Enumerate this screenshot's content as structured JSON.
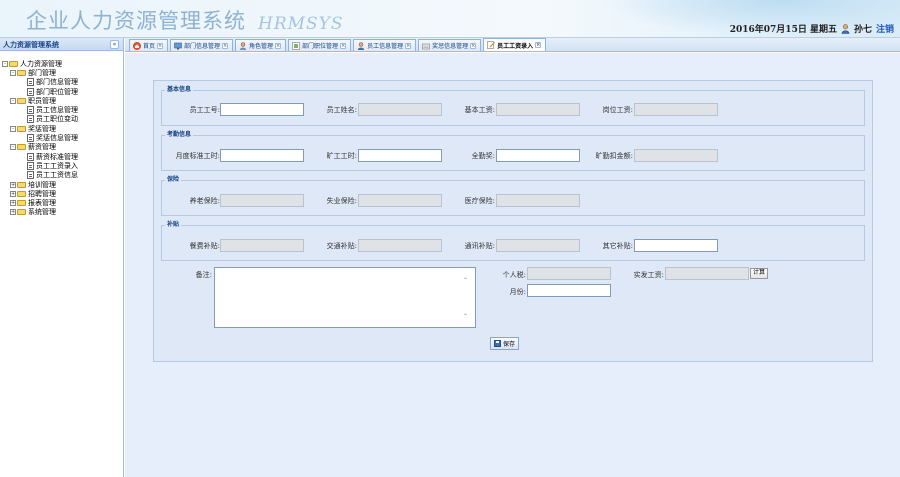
{
  "header": {
    "title": "企业人力资源管理系统",
    "subtitle": "HRMSYS",
    "datetime": "2016年07月15日 星期五",
    "user_name": "孙七",
    "logout_label": "注销"
  },
  "sidebar": {
    "title": "人力资源管理系统",
    "collapse_symbol": "«",
    "tree": {
      "root": "人力资源管理",
      "groups": [
        {
          "label": "部门管理",
          "expanded": true,
          "children": [
            {
              "label": "部门信息管理"
            },
            {
              "label": "部门职位管理"
            }
          ]
        },
        {
          "label": "职员管理",
          "expanded": true,
          "children": [
            {
              "label": "员工信息管理"
            },
            {
              "label": "员工职位变动"
            }
          ]
        },
        {
          "label": "奖惩管理",
          "expanded": true,
          "children": [
            {
              "label": "奖惩信息管理"
            }
          ]
        },
        {
          "label": "薪资管理",
          "expanded": true,
          "children": [
            {
              "label": "薪资标准管理"
            },
            {
              "label": "员工工资录入"
            },
            {
              "label": "员工工资信息"
            }
          ]
        },
        {
          "label": "培训管理",
          "expanded": false
        },
        {
          "label": "招聘管理",
          "expanded": false
        },
        {
          "label": "报表管理",
          "expanded": false
        },
        {
          "label": "系统管理",
          "expanded": false
        }
      ]
    }
  },
  "tabs": [
    {
      "label": "首页",
      "icon": "home-icon",
      "active": false
    },
    {
      "label": "部门信息管理",
      "icon": "department-icon",
      "active": false
    },
    {
      "label": "角色管理",
      "icon": "role-icon",
      "active": false
    },
    {
      "label": "部门职位管理",
      "icon": "position-icon",
      "active": false
    },
    {
      "label": "员工信息管理",
      "icon": "employee-icon",
      "active": false
    },
    {
      "label": "奖惩信息管理",
      "icon": "reward-icon",
      "active": false
    },
    {
      "label": "员工工资录入",
      "icon": "edit-icon",
      "active": true
    }
  ],
  "form": {
    "basic": {
      "legend": "基本信息",
      "emp_no_label": "员工工号:",
      "emp_name_label": "员工姓名:",
      "base_salary_label": "基本工资:",
      "post_salary_label": "岗位工资:"
    },
    "attendance": {
      "legend": "考勤信息",
      "std_hours_label": "月度标准工时:",
      "absent_hours_label": "旷工工时:",
      "attendance_label": "全勤奖:",
      "deduction_label": "旷勤扣金额:"
    },
    "insurance": {
      "legend": "保险",
      "pension_label": "养老保险:",
      "unemployment_label": "失业保险:",
      "medical_label": "医疗保险:"
    },
    "allowance": {
      "legend": "补贴",
      "meal_label": "餐费补贴:",
      "traffic_label": "交通补贴:",
      "phone_label": "通讯补贴:",
      "other_label": "其它补贴:"
    },
    "remark_label": "备注:",
    "tax_label": "个人税:",
    "actual_salary_label": "实发工资:",
    "calc_label": "计算",
    "month_label": "月份:",
    "save_label": "保存"
  }
}
